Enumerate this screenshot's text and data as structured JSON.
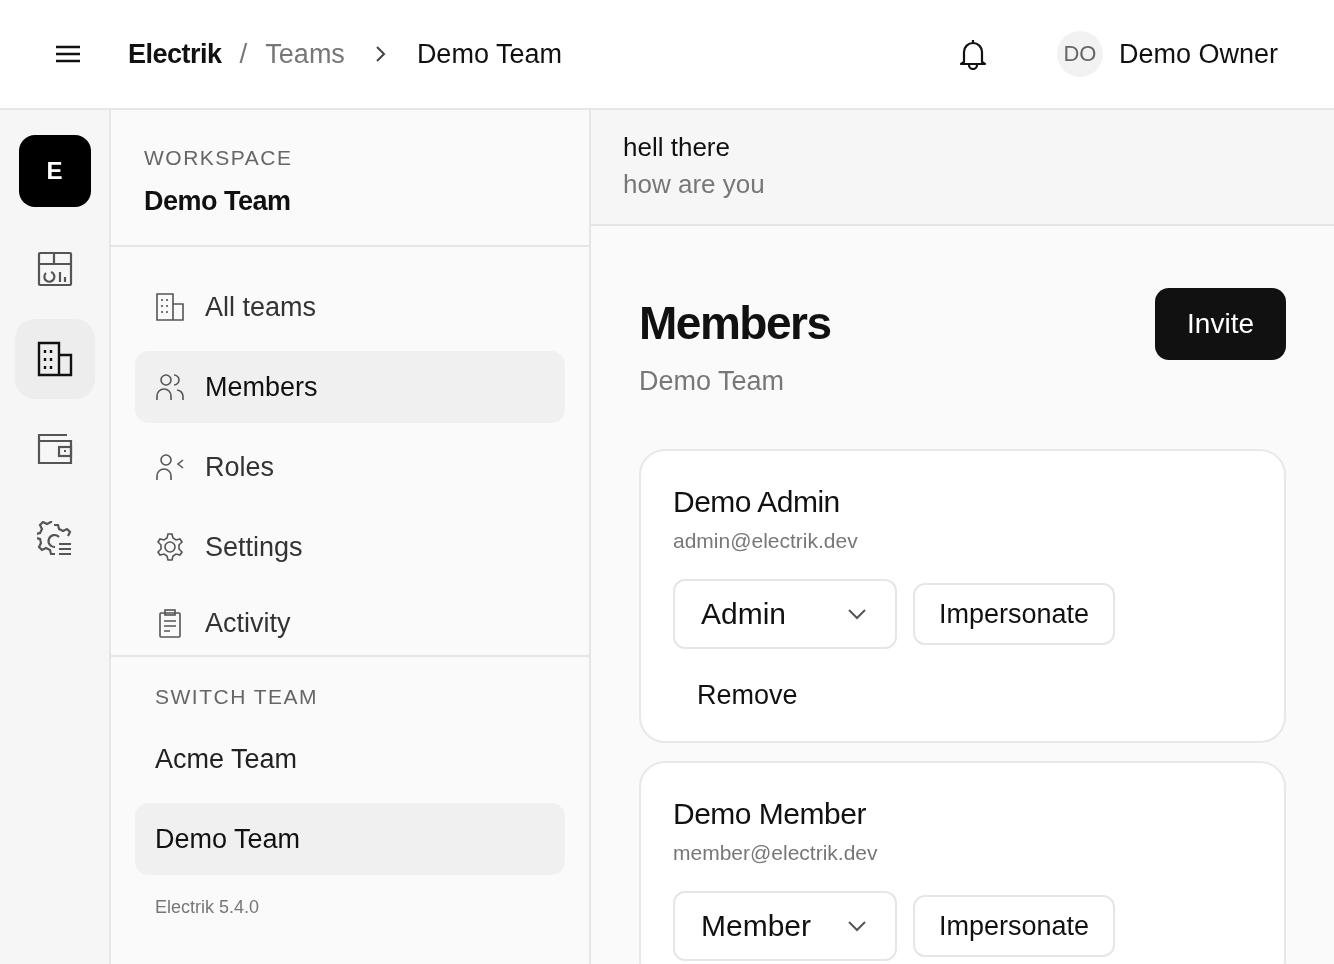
{
  "header": {
    "brand": "Electrik",
    "separator": "/",
    "crumbs": [
      "Teams",
      "Demo Team"
    ],
    "user": {
      "initials": "DO",
      "name": "Demo Owner"
    }
  },
  "rail": {
    "logo": "E",
    "items": [
      {
        "selected": false
      },
      {
        "selected": true
      },
      {
        "selected": false
      },
      {
        "selected": false
      }
    ]
  },
  "sidebar": {
    "section_label": "WORKSPACE",
    "workspace": "Demo Team",
    "nav": [
      {
        "label": "All teams",
        "selected": false
      },
      {
        "label": "Members",
        "selected": true
      },
      {
        "label": "Roles",
        "selected": false
      },
      {
        "label": "Settings",
        "selected": false
      },
      {
        "label": "Activity",
        "selected": false
      }
    ],
    "switch_label": "SWITCH TEAM",
    "teams": [
      {
        "label": "Acme Team",
        "selected": false
      },
      {
        "label": "Demo Team",
        "selected": true
      }
    ],
    "version": "Electrik 5.4.0"
  },
  "banner": {
    "title": "hell there",
    "subtitle": "how are you"
  },
  "page": {
    "title": "Members",
    "subtitle": "Demo Team",
    "invite": "Invite"
  },
  "members": [
    {
      "name": "Demo Admin",
      "email": "admin@electrik.dev",
      "role": "Admin",
      "impersonate": "Impersonate",
      "remove": "Remove"
    },
    {
      "name": "Demo Member",
      "email": "member@electrik.dev",
      "role": "Member",
      "impersonate": "Impersonate"
    }
  ]
}
